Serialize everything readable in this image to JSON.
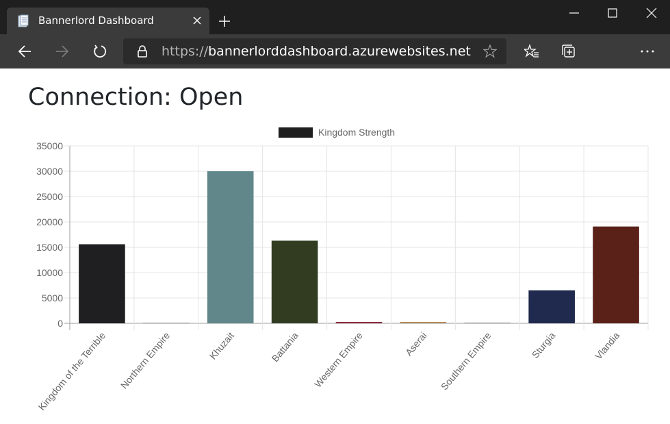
{
  "browser": {
    "tab_title": "Bannerlord Dashboard",
    "url_scheme": "https://",
    "url_host": "bannerlorddashboard.azurewebsites.net"
  },
  "page": {
    "heading": "Connection: Open"
  },
  "chart_data": {
    "type": "bar",
    "title": "",
    "xlabel": "",
    "ylabel": "",
    "legend": {
      "label": "Kingdom Strength",
      "color": "#1f1f1f",
      "position": "top"
    },
    "grid": true,
    "ylim": [
      0,
      35000
    ],
    "yticks": [
      0,
      5000,
      10000,
      15000,
      20000,
      25000,
      30000,
      35000
    ],
    "categories": [
      "Kingdom of the Terrible",
      "Northern Empire",
      "Khuzait",
      "Battania",
      "Western Empire",
      "Aserai",
      "Southern Empire",
      "Sturgia",
      "Vlandia"
    ],
    "series": [
      {
        "name": "Kingdom Strength",
        "values": [
          15600,
          0,
          30000,
          16300,
          200,
          80,
          0,
          6500,
          19100
        ],
        "colors": [
          "#1f1e20",
          "#9b9b9b",
          "#61878a",
          "#323c21",
          "#8a2a3e",
          "#b58a5a",
          "#888888",
          "#1f2a4e",
          "#5a2119"
        ]
      }
    ]
  }
}
